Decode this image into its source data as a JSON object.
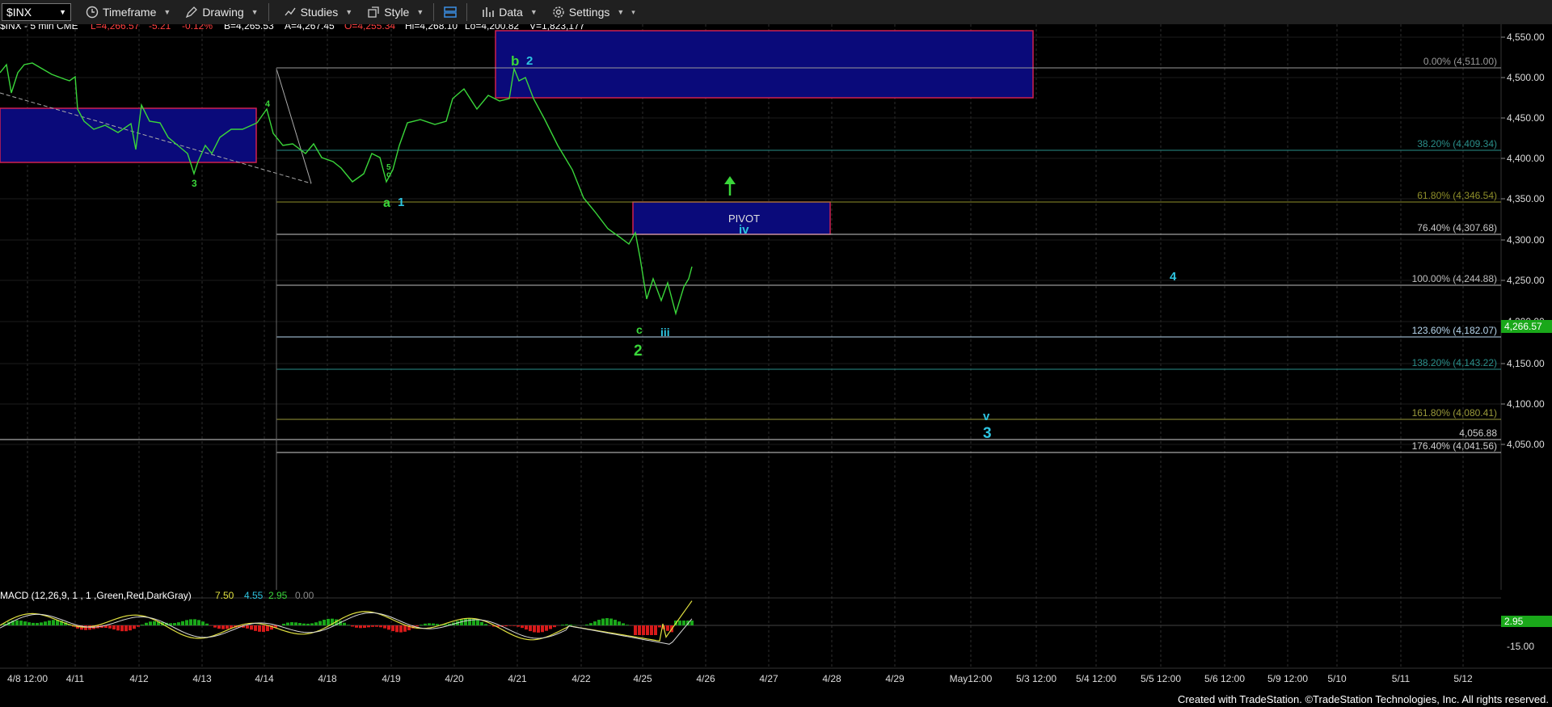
{
  "toolbar": {
    "symbol": "$INX",
    "timeframe": "Timeframe",
    "drawing": "Drawing",
    "studies": "Studies",
    "style": "Style",
    "data": "Data",
    "settings": "Settings"
  },
  "info": {
    "desc": "$INX - 5 min  CME",
    "last": "L=4,266.57",
    "chg": "-5.21",
    "pct": "-0.12%",
    "bid": "B=4,265.53",
    "ask": "A=4,267.45",
    "open": "O=4,255.34",
    "high": "Hi=4,268.10",
    "low": "Lo=4,200.82",
    "vol": "V=1,823,177"
  },
  "price_axis": {
    "labels": [
      "4,550.00",
      "4,500.00",
      "4,450.00",
      "4,400.00",
      "4,350.00",
      "4,300.00",
      "4,250.00",
      "4,200.00",
      "4,150.00",
      "4,100.00",
      "4,050.00"
    ],
    "last_price": "4,266.57"
  },
  "date_axis": [
    "4/8 12:00",
    "4/11",
    "4/12",
    "4/13",
    "4/14",
    "4/18",
    "4/19",
    "4/20",
    "4/21",
    "4/22",
    "4/25",
    "4/26",
    "4/27",
    "4/28",
    "4/29",
    "May12:00",
    "5/3 12:00",
    "5/4 12:00",
    "5/5 12:00",
    "5/6 12:00",
    "5/9 12:00",
    "5/10",
    "5/11",
    "5/12"
  ],
  "fib_levels": [
    {
      "label": "0.00% (4,511.00)",
      "color": "#9a9a9a"
    },
    {
      "label": "38.20% (4,409.34)",
      "color": "#2a8f8a"
    },
    {
      "label": "61.80% (4,346.54)",
      "color": "#8f8f2a"
    },
    {
      "label": "76.40% (4,307.68)",
      "color": "#c8c8c8"
    },
    {
      "label": "100.00% (4,244.88)",
      "color": "#bdbdbd"
    },
    {
      "label": "123.60% (4,182.07)",
      "color": "#b8d8ef"
    },
    {
      "label": "138.20% (4,143.22)",
      "color": "#2a8f8a"
    },
    {
      "label": "161.80% (4,080.41)",
      "color": "#9a9a3a"
    },
    {
      "label": "4,056.88",
      "color": "#cfcfcf"
    },
    {
      "label": "176.40% (4,041.56)",
      "color": "#cfcfcf"
    }
  ],
  "wave_labels": {
    "b": "b",
    "two_top": "2",
    "four": "4",
    "three_low": "3",
    "five": "5",
    "c_small": "c",
    "a": "a",
    "one": "1",
    "c_low": "c",
    "two_low": "2",
    "iii": "iii",
    "iv": "iv",
    "pivot": "PIVOT",
    "v": "v",
    "three_target": "3",
    "four_target": "4"
  },
  "macd": {
    "label": "MACD (12,26,9, 1 , 1 ,Green,Red,DarkGray)",
    "v1": "7.50",
    "v2": "4.55",
    "v3": "2.95",
    "v4": "0.00",
    "axis_val": "2.95",
    "axis_low": "-15.00"
  },
  "footer": "Created with TradeStation. ©TradeStation Technologies, Inc. All rights reserved.",
  "colors": {
    "green": "#3ad63a",
    "cyan": "#2ec4e0",
    "box": "#0a0a7a",
    "box_border": "#d02050"
  }
}
